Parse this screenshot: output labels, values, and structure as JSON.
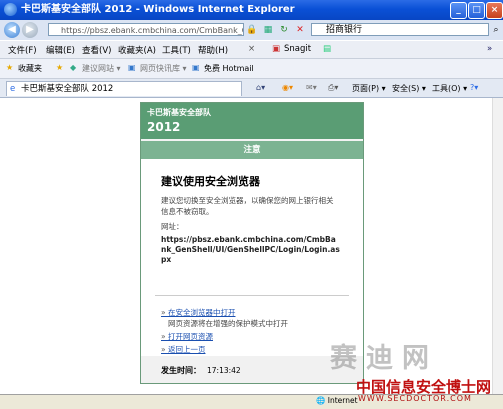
{
  "window": {
    "title": "卡巴斯基安全部队 2012 - Windows Internet Explorer"
  },
  "address_bar": {
    "url": "https://pbsz.ebank.cmbchina.com/CmbBank_Ge",
    "search_text": "招商银行"
  },
  "menu_bar": {
    "items": [
      "文件(F)",
      "编辑(E)",
      "查看(V)",
      "收藏夹(A)",
      "工具(T)",
      "帮助(H)"
    ],
    "snagit": "Snagit"
  },
  "favorites_bar": {
    "label": "收藏夹",
    "items": [
      "建议网站 ▾",
      "网页快讯库 ▾",
      "免费 Hotmail"
    ]
  },
  "tab": {
    "label": "卡巴斯基安全部队 2012"
  },
  "command_bar": {
    "page": "页面(P) ▾",
    "safety": "安全(S) ▾",
    "tools": "工具(O) ▾"
  },
  "dialog": {
    "brand": "卡巴斯基安全部队",
    "year": "2012",
    "note": "注意",
    "heading": "建议使用安全浏览器",
    "desc_line1": "建议您切换至安全浏览器，以确保您的网上银行相关",
    "desc_line2": "信息不被窃取。",
    "url_label": "网址：",
    "url": "https://pbsz.ebank.cmbchina.com/CmbBank_GenShell/UI/GenShellPC/Login/Login.aspx",
    "open_safe_link": "在安全浏览器中打开",
    "open_safe_desc": "网页资源将在增强的保护模式中打开",
    "open_page_link": "打开网页资源",
    "back_link": "返回上一页",
    "time_label": "发生时间：",
    "time_value": "17:13:42"
  },
  "status_bar": {
    "zone": "Internet"
  },
  "watermark": {
    "line1": "赛迪网",
    "line2": "中国信息安全博士网",
    "line3": "WWW.SECDOCTOR.COM"
  }
}
